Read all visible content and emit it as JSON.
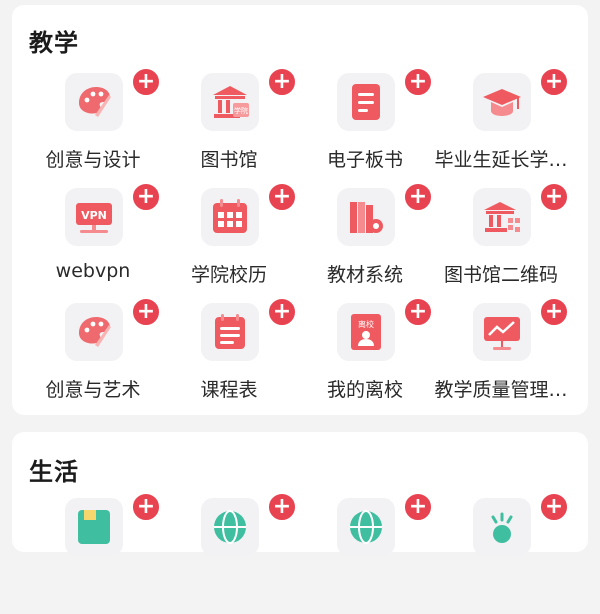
{
  "sections": [
    {
      "title": "教学",
      "items": [
        {
          "label": "创意与设计",
          "icon": "palette-icon"
        },
        {
          "label": "图书馆",
          "icon": "library-building-icon"
        },
        {
          "label": "电子板书",
          "icon": "document-icon"
        },
        {
          "label": "毕业生延长学…",
          "icon": "graduation-cap-icon"
        },
        {
          "label": "webvpn",
          "icon": "vpn-screen-icon"
        },
        {
          "label": "学院校历",
          "icon": "calendar-icon"
        },
        {
          "label": "教材系统",
          "icon": "books-icon"
        },
        {
          "label": "图书馆二维码",
          "icon": "library-qrcode-icon"
        },
        {
          "label": "创意与艺术",
          "icon": "palette-icon"
        },
        {
          "label": "课程表",
          "icon": "schedule-icon"
        },
        {
          "label": "我的离校",
          "icon": "leave-school-icon"
        },
        {
          "label": "教学质量管理…",
          "icon": "presentation-chart-icon"
        }
      ]
    },
    {
      "title": "生活",
      "items": [
        {
          "label": "",
          "icon": "green-card-icon"
        },
        {
          "label": "",
          "icon": "globe-icon"
        },
        {
          "label": "",
          "icon": "globe-icon"
        },
        {
          "label": "",
          "icon": "sparkle-icon"
        }
      ]
    }
  ],
  "add_badge_symbol": "+",
  "colors": {
    "accent": "#e84351",
    "icon_bg": "#f2f2f4",
    "icon_red": "#ee5a5f",
    "teal": "#3fbfa0"
  }
}
